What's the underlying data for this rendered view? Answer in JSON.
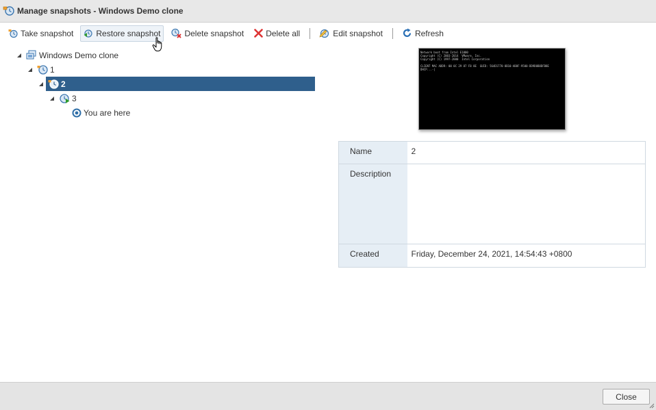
{
  "window": {
    "title": "Manage snapshots - Windows Demo clone"
  },
  "toolbar": {
    "take": "Take snapshot",
    "restore": "Restore snapshot",
    "delete": "Delete snapshot",
    "delete_all": "Delete all",
    "edit": "Edit snapshot",
    "refresh": "Refresh"
  },
  "tree": {
    "root": "Windows Demo clone",
    "n1": "1",
    "n2": "2",
    "n3": "3",
    "here": "You are here"
  },
  "preview": {
    "screen_text": "Network boot from Intel E1000\nCopyright (C) 2003-2014  VMware, Inc.\nCopyright (C) 1997-2000  Intel Corporation\n\nCLIENT MAC ADDR: 00 0C 29 87 F8 8E  GUID: 564D1770-8B10-AB8F-9500-DD9D0B8DFB8E\nDHCP...-|"
  },
  "details": {
    "name_label": "Name",
    "name_value": "2",
    "desc_label": "Description",
    "desc_value": "",
    "created_label": "Created",
    "created_value": "Friday, December 24, 2021, 14:54:43 +0800"
  },
  "footer": {
    "close": "Close"
  },
  "colors": {
    "selection": "#2f5f8c",
    "label_bg": "#e6eef5",
    "accent_green": "#2e9b2e"
  }
}
